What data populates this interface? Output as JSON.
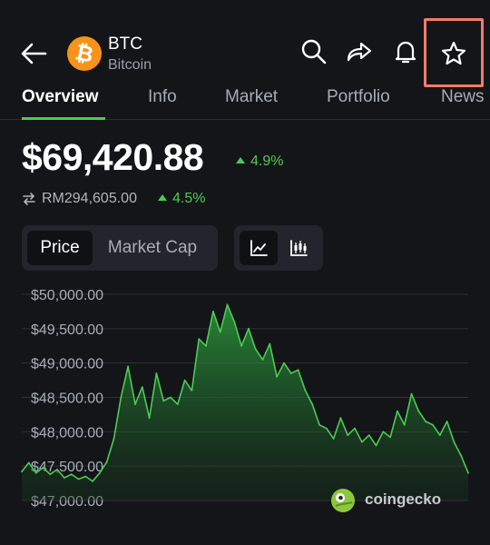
{
  "header": {
    "symbol": "BTC",
    "name": "Bitcoin",
    "icons": [
      "back-arrow-icon",
      "search-icon",
      "share-icon",
      "bell-icon",
      "star-icon"
    ]
  },
  "tabs": [
    {
      "label": "Overview",
      "active": true
    },
    {
      "label": "Info",
      "active": false
    },
    {
      "label": "Market",
      "active": false
    },
    {
      "label": "Portfolio",
      "active": false
    },
    {
      "label": "News",
      "active": false
    }
  ],
  "price": {
    "main": "$69,420.88",
    "main_change": "4.9%",
    "alt": "RM294,605.00",
    "alt_change": "4.5%"
  },
  "toggle": {
    "price_label": "Price",
    "market_cap_label": "Market Cap"
  },
  "colors": {
    "accent_green": "#4bcc54",
    "highlight": "#f07c6a",
    "bitcoin_orange": "#f7931a"
  },
  "watermark": "coingecko",
  "chart_data": {
    "type": "area",
    "y_ticks": [
      "$50,000.00",
      "$49,500.00",
      "$49,000.00",
      "$48,500.00",
      "$48,000.00",
      "$47,500.00",
      "$47,000.00"
    ],
    "ylim": [
      47000,
      50000
    ],
    "grid": true,
    "series": [
      {
        "values": [
          47420,
          47550,
          47400,
          47480,
          47380,
          47450,
          47330,
          47380,
          47310,
          47350,
          47280,
          47400,
          47560,
          47900,
          48500,
          48950,
          48400,
          48650,
          48200,
          48850,
          48450,
          48500,
          48400,
          48750,
          48600,
          49350,
          49250,
          49750,
          49450,
          49850,
          49600,
          49250,
          49500,
          49200,
          49050,
          49280,
          48800,
          49000,
          48850,
          48900,
          48600,
          48400,
          48100,
          48050,
          47900,
          48200,
          47950,
          48050,
          47850,
          47950,
          47800,
          48000,
          47920,
          48300,
          48100,
          48550,
          48300,
          48150,
          48100,
          47950,
          48150,
          47850,
          47650,
          47400
        ]
      }
    ]
  }
}
